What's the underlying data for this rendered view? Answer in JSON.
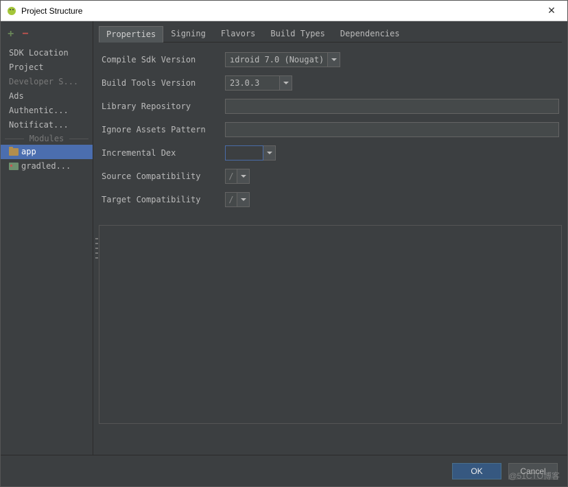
{
  "window": {
    "title": "Project Structure"
  },
  "sidebar": {
    "items": [
      {
        "label": "SDK Location"
      },
      {
        "label": "Project"
      },
      {
        "label": "Developer S..."
      },
      {
        "label": "Ads"
      },
      {
        "label": "Authentic..."
      },
      {
        "label": "Notificat..."
      }
    ],
    "modules_heading": "Modules",
    "modules": [
      {
        "label": "app",
        "icon": "folder"
      },
      {
        "label": "gradled...",
        "icon": "gradle"
      }
    ]
  },
  "tabs": [
    {
      "label": "Properties",
      "active": true
    },
    {
      "label": "Signing"
    },
    {
      "label": "Flavors"
    },
    {
      "label": "Build Types"
    },
    {
      "label": "Dependencies"
    }
  ],
  "form": {
    "compile_sdk": {
      "label": "Compile Sdk Version",
      "value": "ıdroid 7.0 (Nougat)"
    },
    "build_tools": {
      "label": "Build Tools Version",
      "value": "23.0.3"
    },
    "library_repo": {
      "label": "Library Repository",
      "value": ""
    },
    "ignore_assets": {
      "label": "Ignore Assets Pattern",
      "value": ""
    },
    "incremental_dex": {
      "label": "Incremental Dex",
      "value": ""
    },
    "source_compat": {
      "label": "Source Compatibility",
      "value": "/"
    },
    "target_compat": {
      "label": "Target Compatibility",
      "value": "/"
    }
  },
  "footer": {
    "ok": "OK",
    "cancel": "Cancel"
  },
  "watermark": "@51CTO博客"
}
